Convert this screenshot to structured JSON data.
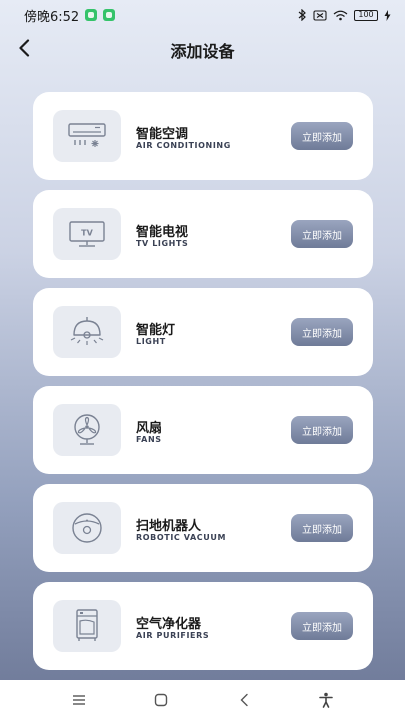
{
  "status_bar": {
    "time": "傍晚6:52",
    "battery": "100"
  },
  "header": {
    "title": "添加设备"
  },
  "devices": [
    {
      "name": "智能空调",
      "subtitle": "AIR CONDITIONING",
      "button": "立即添加",
      "icon": "air-conditioner-icon"
    },
    {
      "name": "智能电视",
      "subtitle": "TV LIGHTS",
      "button": "立即添加",
      "icon": "tv-icon"
    },
    {
      "name": "智能灯",
      "subtitle": "LIGHT",
      "button": "立即添加",
      "icon": "lamp-icon"
    },
    {
      "name": "风扇",
      "subtitle": "FANS",
      "button": "立即添加",
      "icon": "fan-icon"
    },
    {
      "name": "扫地机器人",
      "subtitle": "ROBOTIC VACUUM",
      "button": "立即添加",
      "icon": "robot-vacuum-icon"
    },
    {
      "name": "空气净化器",
      "subtitle": "AIR PURIFIERS",
      "button": "立即添加",
      "icon": "air-purifier-icon"
    }
  ],
  "nav_bar": {
    "items": [
      "menu",
      "home",
      "back",
      "accessibility"
    ]
  },
  "colors": {
    "button": "#7f8aa6",
    "card": "#ffffff",
    "icon_bg": "#e8ebf1",
    "icon_stroke": "#7a8293"
  }
}
